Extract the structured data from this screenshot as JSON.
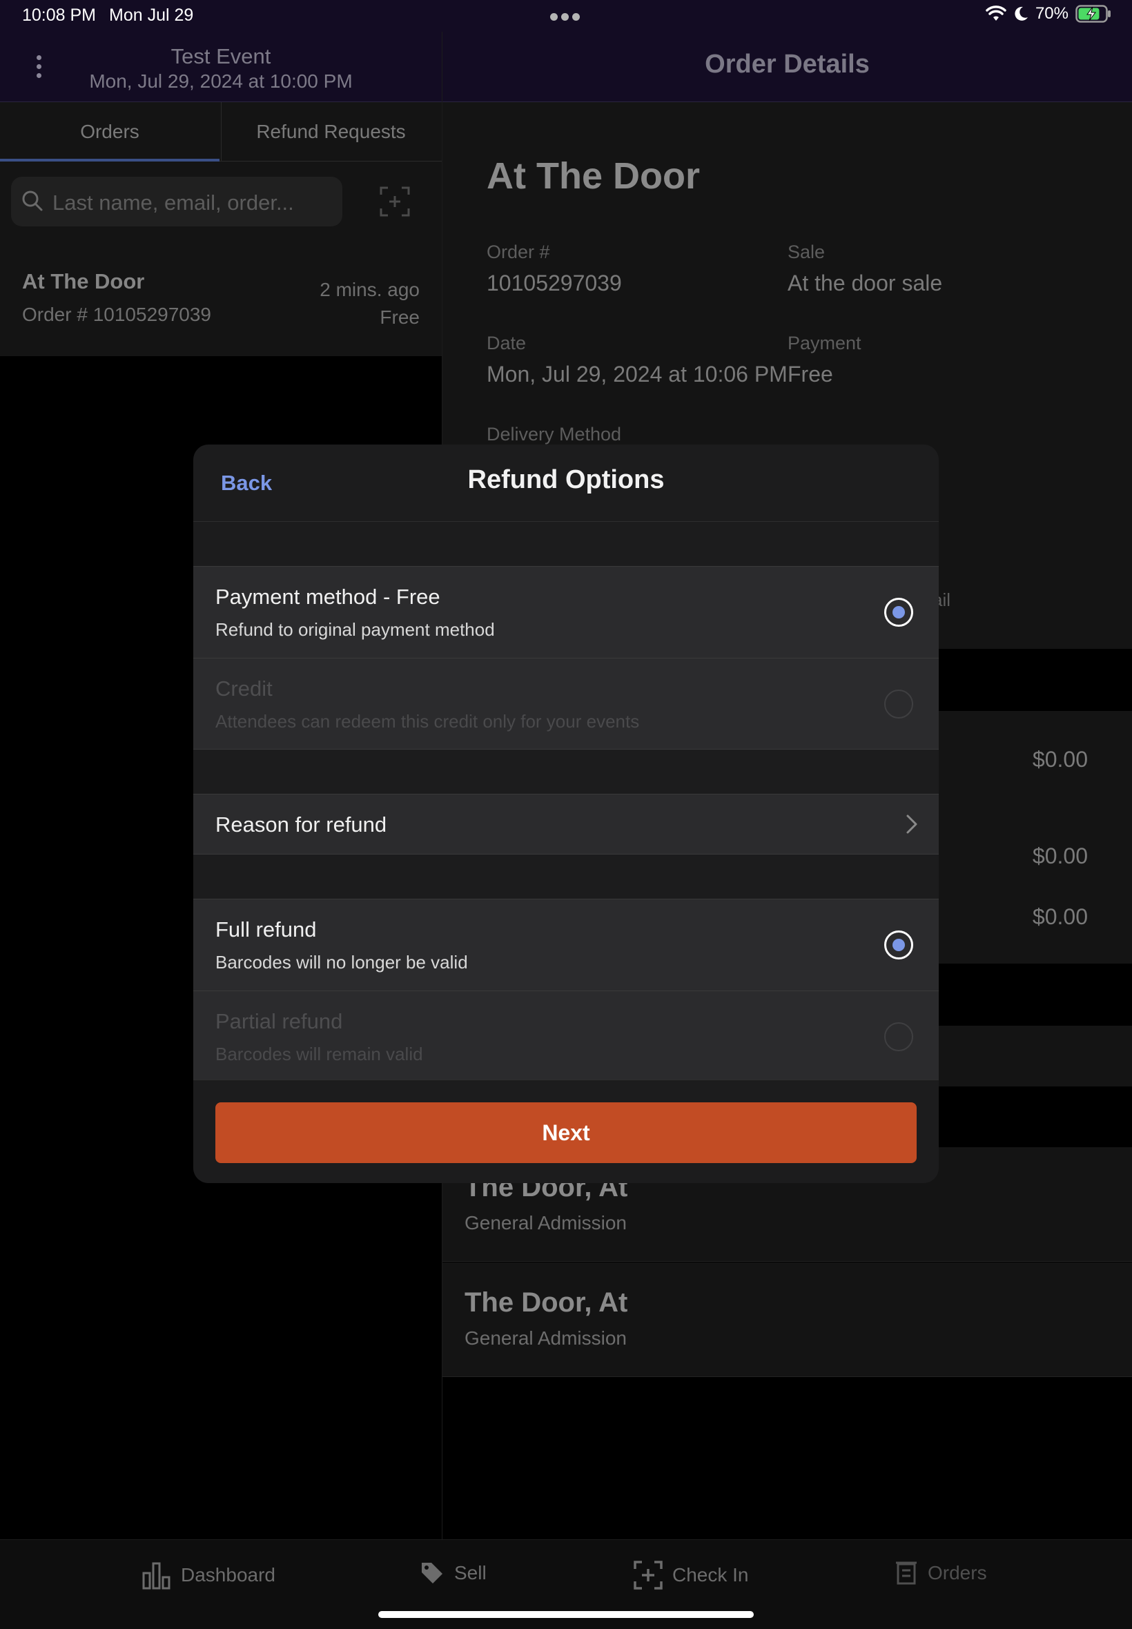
{
  "status_bar": {
    "time": "10:08 PM",
    "date": "Mon Jul 29",
    "battery": "70%"
  },
  "left": {
    "event_title": "Test Event",
    "event_date": "Mon, Jul 29, 2024 at 10:00 PM",
    "tabs": [
      {
        "label": "Orders",
        "active": true
      },
      {
        "label": "Refund Requests",
        "active": false
      }
    ],
    "search": {
      "placeholder": "Last name, email, order..."
    },
    "orders": [
      {
        "title": "At The Door",
        "number": "Order # 10105297039",
        "time": "2 mins. ago",
        "price": "Free"
      }
    ]
  },
  "right": {
    "header_title": "Order Details",
    "title": "At The Door",
    "fields": {
      "order_label": "Order #",
      "order_value": "10105297039",
      "sale_label": "Sale",
      "sale_value": "At the door sale",
      "date_label": "Date",
      "date_value": "Mon, Jul 29, 2024 at 10:06 PM",
      "payment_label": "Payment",
      "payment_value": "Free",
      "delivery_label": "Delivery Method"
    },
    "share_label_fragment": "ail",
    "summary_values": [
      "$0.00",
      "$0.00",
      "$0.00"
    ],
    "attendees": [
      {
        "name": "The Door, At",
        "type": "General Admission"
      },
      {
        "name": "The Door, At",
        "type": "General Admission"
      }
    ]
  },
  "modal": {
    "back": "Back",
    "title": "Refund Options",
    "refund_methods": [
      {
        "title": "Payment method - Free",
        "subtitle": "Refund to original payment method",
        "selected": true,
        "enabled": true
      },
      {
        "title": "Credit",
        "subtitle": "Attendees can redeem this credit only for your events",
        "selected": false,
        "enabled": false
      }
    ],
    "reason_label": "Reason for refund",
    "refund_types": [
      {
        "title": "Full refund",
        "subtitle": "Barcodes will no longer be valid",
        "selected": true,
        "enabled": true
      },
      {
        "title": "Partial refund",
        "subtitle": "Barcodes will remain valid",
        "selected": false,
        "enabled": false
      }
    ],
    "next_label": "Next",
    "accent_color": "#7b97e6",
    "button_color": "#c24c24"
  },
  "tabbar": {
    "items": [
      {
        "label": "Dashboard",
        "icon": "bar-chart-icon"
      },
      {
        "label": "Sell",
        "icon": "tag-icon"
      },
      {
        "label": "Check In",
        "icon": "scan-icon"
      },
      {
        "label": "Orders",
        "icon": "receipt-icon"
      }
    ]
  }
}
